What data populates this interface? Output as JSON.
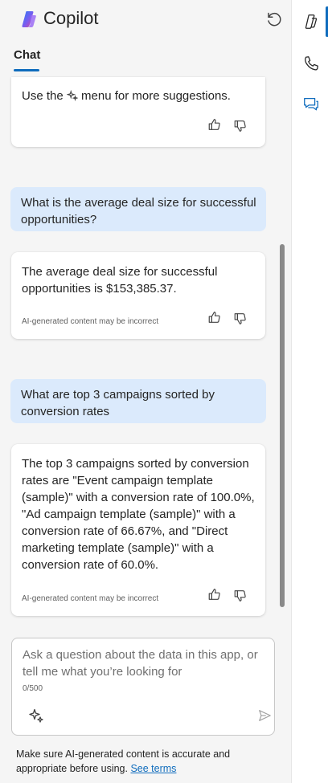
{
  "header": {
    "title": "Copilot",
    "logo_icon": "copilot-logo-icon",
    "refresh_icon": "refresh-icon"
  },
  "tabs": [
    {
      "label": "Chat",
      "active": true
    }
  ],
  "messages": [
    {
      "role": "assistant",
      "text": "Use the ✧ menu for more suggestions.",
      "text_pre": "Use the ",
      "text_post": " menu for more suggestions.",
      "disclaimer": ""
    },
    {
      "role": "user",
      "line1": "What is the average deal size for successful",
      "line2": "opportunities?"
    },
    {
      "role": "assistant",
      "line1": "The average deal size for successful",
      "line2": "opportunities is $153,385.37.",
      "disclaimer": "AI-generated content may be incorrect"
    },
    {
      "role": "user",
      "line1": "What are top 3 campaigns sorted by",
      "line2": "conversion rates"
    },
    {
      "role": "assistant",
      "lines": [
        "The top 3 campaigns sorted by conversion",
        "rates are \"Event campaign template",
        "(sample)\" with a conversion rate of 100.0%,",
        "\"Ad campaign template (sample)\" with a",
        "conversion rate of 66.67%, and \"Direct",
        "marketing template (sample)\" with a",
        "conversion rate of 60.0%."
      ],
      "disclaimer": "AI-generated content may be incorrect"
    }
  ],
  "composer": {
    "placeholder_line1": "Ask a question about the data in this app, or",
    "placeholder_line2": "tell me what you’re looking for",
    "counter": "0/500"
  },
  "footer": {
    "text_line1": "Make sure AI-generated content is accurate and",
    "text_line2": "appropriate before using.",
    "link": "See terms"
  },
  "rail": {
    "items": [
      "copilot-rail-icon",
      "phone-icon",
      "chat-bubble-icon"
    ]
  },
  "colors": {
    "accent": "#0f6cbd",
    "user_bubble": "#dbeafc",
    "pane_bg": "#f5f5f5"
  }
}
